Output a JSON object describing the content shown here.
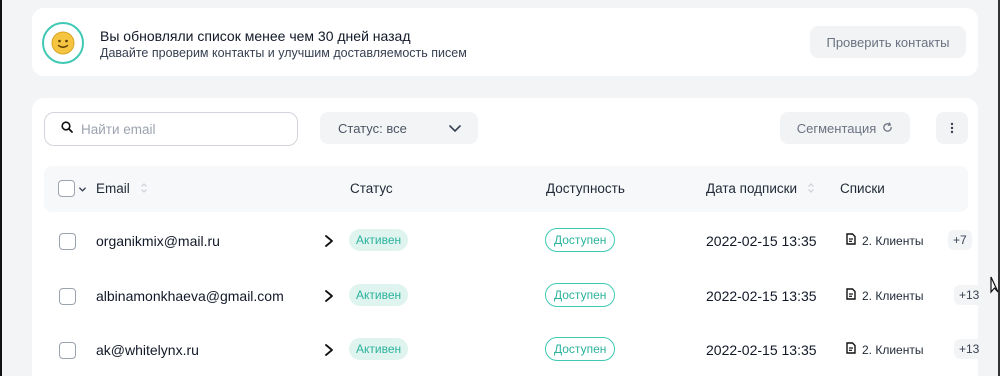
{
  "notice": {
    "title": "Вы обновляли список менее чем 30 дней назад",
    "subtitle": "Давайте проверим контакты и улучшим доставляемость писем",
    "button": "Проверить контакты",
    "icon": "smiley-emoji"
  },
  "toolbar": {
    "search_placeholder": "Найти email",
    "status_select": "Статус: все",
    "segment_button": "Сегментация",
    "more_icon": "more-vertical-icon"
  },
  "table": {
    "headers": {
      "email": "Email",
      "status": "Статус",
      "availability": "Доступность",
      "subscribed": "Дата подписки",
      "lists": "Списки"
    },
    "rows": [
      {
        "email": "organikmix@mail.ru",
        "status": "Активен",
        "availability": "Доступен",
        "date": "2022-02-15 13:35",
        "list": "2. Клиенты",
        "more": "+7"
      },
      {
        "email": "albinamonkhaeva@gmail.com",
        "status": "Активен",
        "availability": "Доступен",
        "date": "2022-02-15 13:35",
        "list": "2. Клиенты",
        "more": "+13"
      },
      {
        "email": "ak@whitelynx.ru",
        "status": "Активен",
        "availability": "Доступен",
        "date": "2022-02-15 13:35",
        "list": "2. Клиенты",
        "more": "+13"
      }
    ]
  },
  "colors": {
    "accent": "#3fc9b4",
    "badge_bg": "#dff4ef",
    "badge_text": "#2bb39c"
  }
}
